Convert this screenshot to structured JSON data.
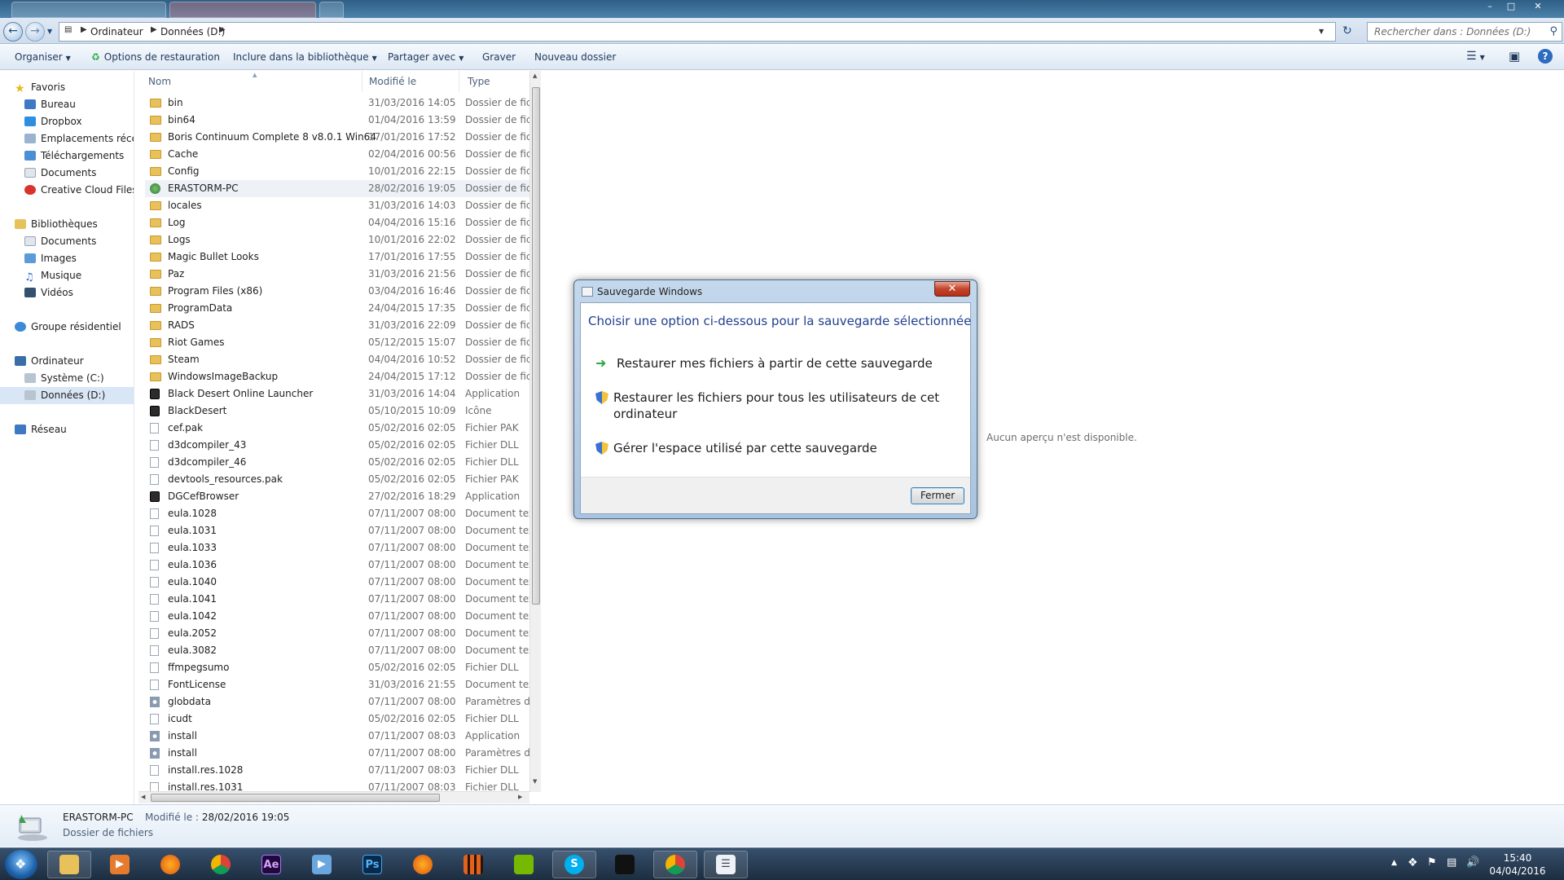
{
  "address": {
    "crumbs": [
      "Ordinateur",
      "Données (D:)"
    ],
    "search_placeholder": "Rechercher dans : Données (D:)"
  },
  "toolbar": {
    "organiser": "Organiser",
    "restore_options": "Options de restauration",
    "include_library": "Inclure dans la bibliothèque",
    "share_with": "Partager avec",
    "burn": "Graver",
    "new_folder": "Nouveau dossier"
  },
  "nav": {
    "favorites": "Favoris",
    "fav_items": [
      "Bureau",
      "Dropbox",
      "Emplacements récents",
      "Téléchargements",
      "Documents",
      "Creative Cloud Files"
    ],
    "libraries": "Bibliothèques",
    "lib_items": [
      "Documents",
      "Images",
      "Musique",
      "Vidéos"
    ],
    "homegroup": "Groupe résidentiel",
    "computer": "Ordinateur",
    "drives": [
      "Système (C:)",
      "Données (D:)"
    ],
    "network": "Réseau"
  },
  "columns": {
    "name": "Nom",
    "modified": "Modifié le",
    "type": "Type"
  },
  "files": [
    {
      "name": "bin",
      "date": "31/03/2016 14:05",
      "type": "Dossier de fichiers",
      "icon": "folder"
    },
    {
      "name": "bin64",
      "date": "01/04/2016 13:59",
      "type": "Dossier de fichiers",
      "icon": "folder"
    },
    {
      "name": "Boris Continuum Complete 8 v8.0.1 Win64",
      "date": "17/01/2016 17:52",
      "type": "Dossier de fichiers",
      "icon": "folder"
    },
    {
      "name": "Cache",
      "date": "02/04/2016 00:56",
      "type": "Dossier de fichiers",
      "icon": "folder"
    },
    {
      "name": "Config",
      "date": "10/01/2016 22:15",
      "type": "Dossier de fichiers",
      "icon": "folder"
    },
    {
      "name": "ERASTORM-PC",
      "date": "28/02/2016 19:05",
      "type": "Dossier de fichiers",
      "icon": "net"
    },
    {
      "name": "locales",
      "date": "31/03/2016 14:03",
      "type": "Dossier de fichiers",
      "icon": "folder"
    },
    {
      "name": "Log",
      "date": "04/04/2016 15:16",
      "type": "Dossier de fichiers",
      "icon": "folder"
    },
    {
      "name": "Logs",
      "date": "10/01/2016 22:02",
      "type": "Dossier de fichiers",
      "icon": "folder"
    },
    {
      "name": "Magic Bullet Looks",
      "date": "17/01/2016 17:55",
      "type": "Dossier de fichiers",
      "icon": "folder"
    },
    {
      "name": "Paz",
      "date": "31/03/2016 21:56",
      "type": "Dossier de fichiers",
      "icon": "folder"
    },
    {
      "name": "Program Files (x86)",
      "date": "03/04/2016 16:46",
      "type": "Dossier de fichiers",
      "icon": "folder"
    },
    {
      "name": "ProgramData",
      "date": "24/04/2015 17:35",
      "type": "Dossier de fichiers",
      "icon": "folder"
    },
    {
      "name": "RADS",
      "date": "31/03/2016 22:09",
      "type": "Dossier de fichiers",
      "icon": "folder"
    },
    {
      "name": "Riot Games",
      "date": "05/12/2015 15:07",
      "type": "Dossier de fichiers",
      "icon": "folder"
    },
    {
      "name": "Steam",
      "date": "04/04/2016 10:52",
      "type": "Dossier de fichiers",
      "icon": "folder"
    },
    {
      "name": "WindowsImageBackup",
      "date": "24/04/2015 17:12",
      "type": "Dossier de fichiers",
      "icon": "folder"
    },
    {
      "name": "Black Desert Online Launcher",
      "date": "31/03/2016 14:04",
      "type": "Application",
      "icon": "app"
    },
    {
      "name": "BlackDesert",
      "date": "05/10/2015 10:09",
      "type": "Icône",
      "icon": "app"
    },
    {
      "name": "cef.pak",
      "date": "05/02/2016 02:05",
      "type": "Fichier PAK",
      "icon": "file"
    },
    {
      "name": "d3dcompiler_43",
      "date": "05/02/2016 02:05",
      "type": "Fichier DLL",
      "icon": "file"
    },
    {
      "name": "d3dcompiler_46",
      "date": "05/02/2016 02:05",
      "type": "Fichier DLL",
      "icon": "file"
    },
    {
      "name": "devtools_resources.pak",
      "date": "05/02/2016 02:05",
      "type": "Fichier PAK",
      "icon": "file"
    },
    {
      "name": "DGCefBrowser",
      "date": "27/02/2016 18:29",
      "type": "Application",
      "icon": "app"
    },
    {
      "name": "eula.1028",
      "date": "07/11/2007 08:00",
      "type": "Document texte",
      "icon": "file"
    },
    {
      "name": "eula.1031",
      "date": "07/11/2007 08:00",
      "type": "Document texte",
      "icon": "file"
    },
    {
      "name": "eula.1033",
      "date": "07/11/2007 08:00",
      "type": "Document texte",
      "icon": "file"
    },
    {
      "name": "eula.1036",
      "date": "07/11/2007 08:00",
      "type": "Document texte",
      "icon": "file"
    },
    {
      "name": "eula.1040",
      "date": "07/11/2007 08:00",
      "type": "Document texte",
      "icon": "file"
    },
    {
      "name": "eula.1041",
      "date": "07/11/2007 08:00",
      "type": "Document texte",
      "icon": "file"
    },
    {
      "name": "eula.1042",
      "date": "07/11/2007 08:00",
      "type": "Document texte",
      "icon": "file"
    },
    {
      "name": "eula.2052",
      "date": "07/11/2007 08:00",
      "type": "Document texte",
      "icon": "file"
    },
    {
      "name": "eula.3082",
      "date": "07/11/2007 08:00",
      "type": "Document texte",
      "icon": "file"
    },
    {
      "name": "ffmpegsumo",
      "date": "05/02/2016 02:05",
      "type": "Fichier DLL",
      "icon": "file"
    },
    {
      "name": "FontLicense",
      "date": "31/03/2016 21:55",
      "type": "Document texte",
      "icon": "file"
    },
    {
      "name": "globdata",
      "date": "07/11/2007 08:00",
      "type": "Paramètres de configuration",
      "icon": "gear"
    },
    {
      "name": "icudt",
      "date": "05/02/2016 02:05",
      "type": "Fichier DLL",
      "icon": "file"
    },
    {
      "name": "install",
      "date": "07/11/2007 08:03",
      "type": "Application",
      "icon": "gear"
    },
    {
      "name": "install",
      "date": "07/11/2007 08:00",
      "type": "Paramètres de configuration",
      "icon": "gear"
    },
    {
      "name": "install.res.1028",
      "date": "07/11/2007 08:03",
      "type": "Fichier DLL",
      "icon": "file"
    },
    {
      "name": "install.res.1031",
      "date": "07/11/2007 08:03",
      "type": "Fichier DLL",
      "icon": "file"
    }
  ],
  "preview": {
    "no_preview": "Aucun aperçu n'est disponible."
  },
  "dialog": {
    "title": "Sauvegarde Windows",
    "heading": "Choisir une option ci-dessous pour la sauvegarde sélectionnée",
    "options": [
      "Restaurer mes fichiers à partir de cette sauvegarde",
      "Restaurer les fichiers pour tous les utilisateurs de cet ordinateur",
      "Gérer l'espace utilisé par cette sauvegarde"
    ],
    "close_button": "Fermer"
  },
  "details": {
    "name": "ERASTORM-PC",
    "modified_label": "Modifié le :",
    "modified_value": "28/02/2016 19:05",
    "type": "Dossier de fichiers"
  },
  "taskbar": {
    "apps": [
      "explorer",
      "media-player",
      "firefox",
      "chrome",
      "after-effects",
      "media-center",
      "photoshop",
      "firefox-dev",
      "game-launcher",
      "nvidia",
      "skype",
      "black-desert",
      "chrome-2",
      "task-list"
    ],
    "ae_label": "Ae",
    "ps_label": "Ps",
    "time": "15:40",
    "date": "04/04/2016"
  },
  "colors": {
    "accent": "#1f3f8f",
    "selection": "#d9e6f5",
    "folder": "#e8c15a",
    "close_red": "#c2452c"
  }
}
